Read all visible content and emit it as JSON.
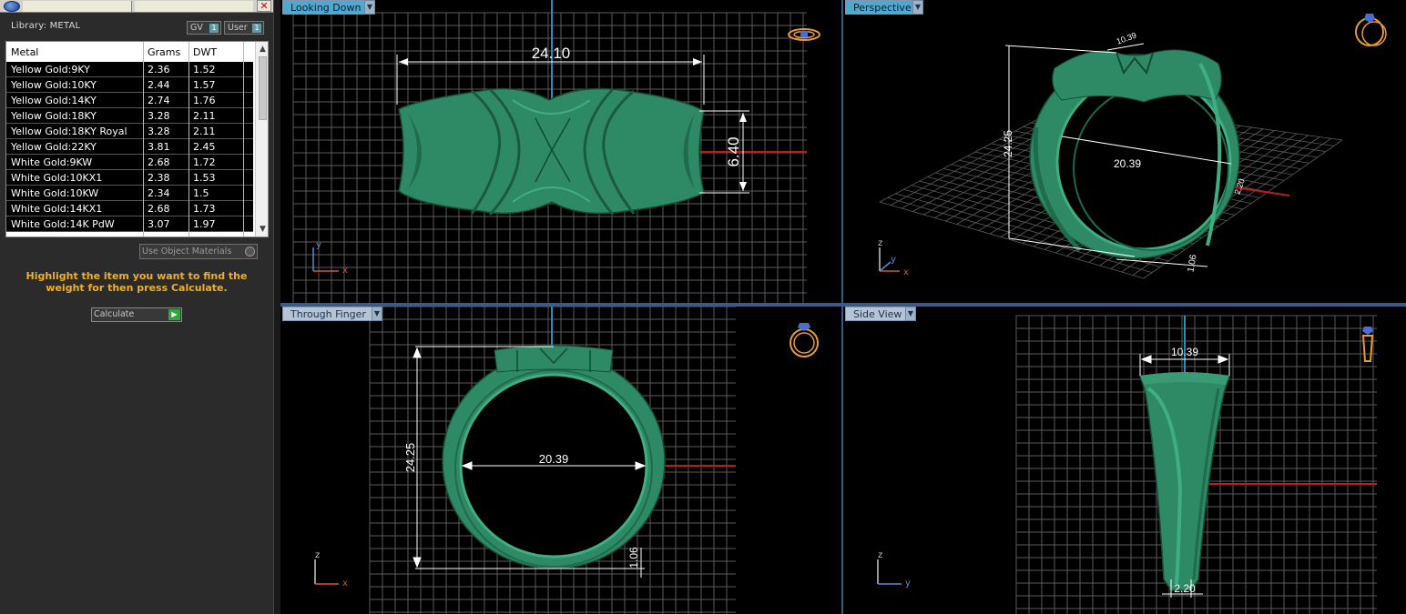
{
  "library": {
    "label": "Library: METAL",
    "gv_label": "GV",
    "gv_num": "1",
    "user_label": "User",
    "user_num": "1",
    "headers": {
      "metal": "Metal",
      "grams": "Grams",
      "dwt": "DWT"
    },
    "rows": [
      {
        "metal": "Yellow Gold:9KY",
        "grams": "2.36",
        "dwt": "1.52"
      },
      {
        "metal": "Yellow Gold:10KY",
        "grams": "2.44",
        "dwt": "1.57"
      },
      {
        "metal": "Yellow Gold:14KY",
        "grams": "2.74",
        "dwt": "1.76"
      },
      {
        "metal": "Yellow Gold:18KY",
        "grams": "3.28",
        "dwt": "2.11"
      },
      {
        "metal": "Yellow Gold:18KY Royal",
        "grams": "3.28",
        "dwt": "2.11"
      },
      {
        "metal": "Yellow Gold:22KY",
        "grams": "3.81",
        "dwt": "2.45"
      },
      {
        "metal": "White Gold:9KW",
        "grams": "2.68",
        "dwt": "1.72"
      },
      {
        "metal": "White Gold:10KX1",
        "grams": "2.38",
        "dwt": "1.53"
      },
      {
        "metal": "White Gold:10KW",
        "grams": "2.34",
        "dwt": "1.5"
      },
      {
        "metal": "White Gold:14KX1",
        "grams": "2.68",
        "dwt": "1.73"
      },
      {
        "metal": "White Gold:14K PdW",
        "grams": "3.07",
        "dwt": "1.97"
      }
    ],
    "use_object_materials": "Use Object Materials",
    "hint": "Highlight the item you want to find the weight for then press Calculate.",
    "calculate": "Calculate"
  },
  "viewports": {
    "looking_down": {
      "label": "Looking Down",
      "width": "24.10",
      "height": "6.40",
      "axis_v": "y",
      "axis_h": "x"
    },
    "perspective": {
      "label": "Perspective",
      "top": "10.39",
      "height": "24.25",
      "inner": "20.39",
      "small1": "2.20",
      "bottom": "1.06",
      "axis_v": "z",
      "axis_y": "y",
      "axis_h": "x"
    },
    "through_finger": {
      "label": "Through Finger",
      "height": "24.25",
      "inner": "20.39",
      "bottom": "1.06",
      "axis_v": "z",
      "axis_h": "x"
    },
    "side_view": {
      "label": "Side View",
      "top": "10.39",
      "bottom": "2.20",
      "axis_v": "z",
      "axis_h": "y"
    }
  },
  "colors": {
    "ring": "#2e8a65",
    "grid": "#5a5a5a",
    "accent": "#4ea9d0",
    "hint": "#f0b020"
  }
}
